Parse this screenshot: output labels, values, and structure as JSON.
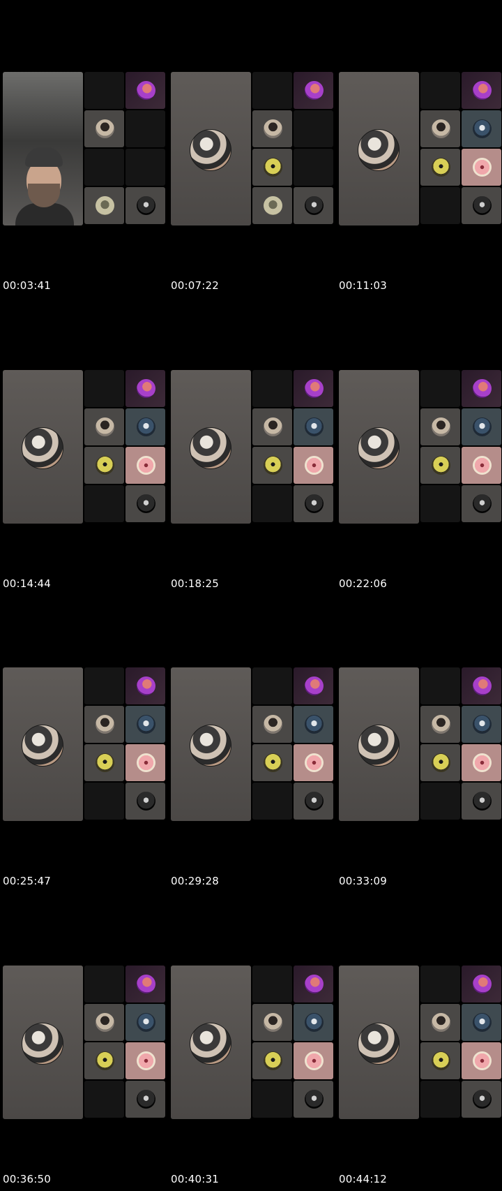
{
  "timestamps": [
    "00:03:41",
    "00:07:22",
    "00:11:03",
    "00:14:44",
    "00:18:25",
    "00:22:06",
    "00:25:47",
    "00:29:28",
    "00:33:09",
    "00:36:50",
    "00:40:31",
    "00:44:12"
  ],
  "frames": [
    {
      "main": "camera",
      "tiles": [
        "empty",
        "purple-avatar",
        "woman-avatar",
        "empty",
        "empty",
        "empty",
        "money-avatar",
        "dark-avatar"
      ]
    },
    {
      "main": "avatar",
      "tiles": [
        "empty",
        "purple-avatar",
        "woman-avatar",
        "empty",
        "minion-avatar",
        "empty",
        "money-avatar",
        "dark-avatar"
      ]
    },
    {
      "main": "avatar",
      "tiles": [
        "empty",
        "purple-avatar",
        "woman-avatar",
        "guy-avatar",
        "minion-avatar",
        "pinkface-avatar",
        "empty",
        "dark-avatar"
      ]
    },
    {
      "main": "avatar",
      "tiles": [
        "empty",
        "purple-avatar",
        "woman-avatar",
        "guy-avatar",
        "minion-avatar",
        "pinkface-avatar",
        "empty",
        "dark-avatar"
      ]
    },
    {
      "main": "avatar",
      "tiles": [
        "empty",
        "purple-avatar",
        "woman-avatar",
        "guy-avatar",
        "minion-avatar",
        "pinkface-avatar",
        "empty",
        "dark-avatar"
      ]
    },
    {
      "main": "avatar",
      "tiles": [
        "empty",
        "purple-avatar",
        "woman-avatar",
        "guy-avatar",
        "minion-avatar",
        "pinkface-avatar",
        "empty",
        "dark-avatar"
      ]
    },
    {
      "main": "avatar",
      "tiles": [
        "empty",
        "purple-avatar",
        "woman-avatar",
        "guy-avatar",
        "minion-avatar",
        "pinkface-avatar",
        "empty",
        "dark-avatar"
      ]
    },
    {
      "main": "avatar",
      "tiles": [
        "empty",
        "purple-avatar",
        "woman-avatar",
        "guy-avatar",
        "minion-avatar",
        "pinkface-avatar",
        "empty",
        "dark-avatar"
      ]
    },
    {
      "main": "avatar",
      "tiles": [
        "empty",
        "purple-avatar",
        "woman-avatar",
        "guy-avatar",
        "minion-avatar",
        "pinkface-avatar",
        "empty",
        "dark-avatar"
      ]
    },
    {
      "main": "avatar",
      "tiles": [
        "empty",
        "purple-avatar",
        "woman-avatar",
        "guy-avatar",
        "minion-avatar",
        "pinkface-avatar",
        "empty",
        "dark-avatar"
      ]
    },
    {
      "main": "avatar",
      "tiles": [
        "empty",
        "purple-avatar",
        "woman-avatar",
        "guy-avatar",
        "minion-avatar",
        "pinkface-avatar",
        "empty",
        "dark-avatar"
      ]
    },
    {
      "main": "avatar",
      "tiles": [
        "empty",
        "purple-avatar",
        "woman-avatar",
        "guy-avatar",
        "minion-avatar",
        "pinkface-avatar",
        "empty",
        "dark-avatar"
      ]
    }
  ],
  "colors": {
    "background": "#000000",
    "timestamp_text": "#ffffff"
  }
}
